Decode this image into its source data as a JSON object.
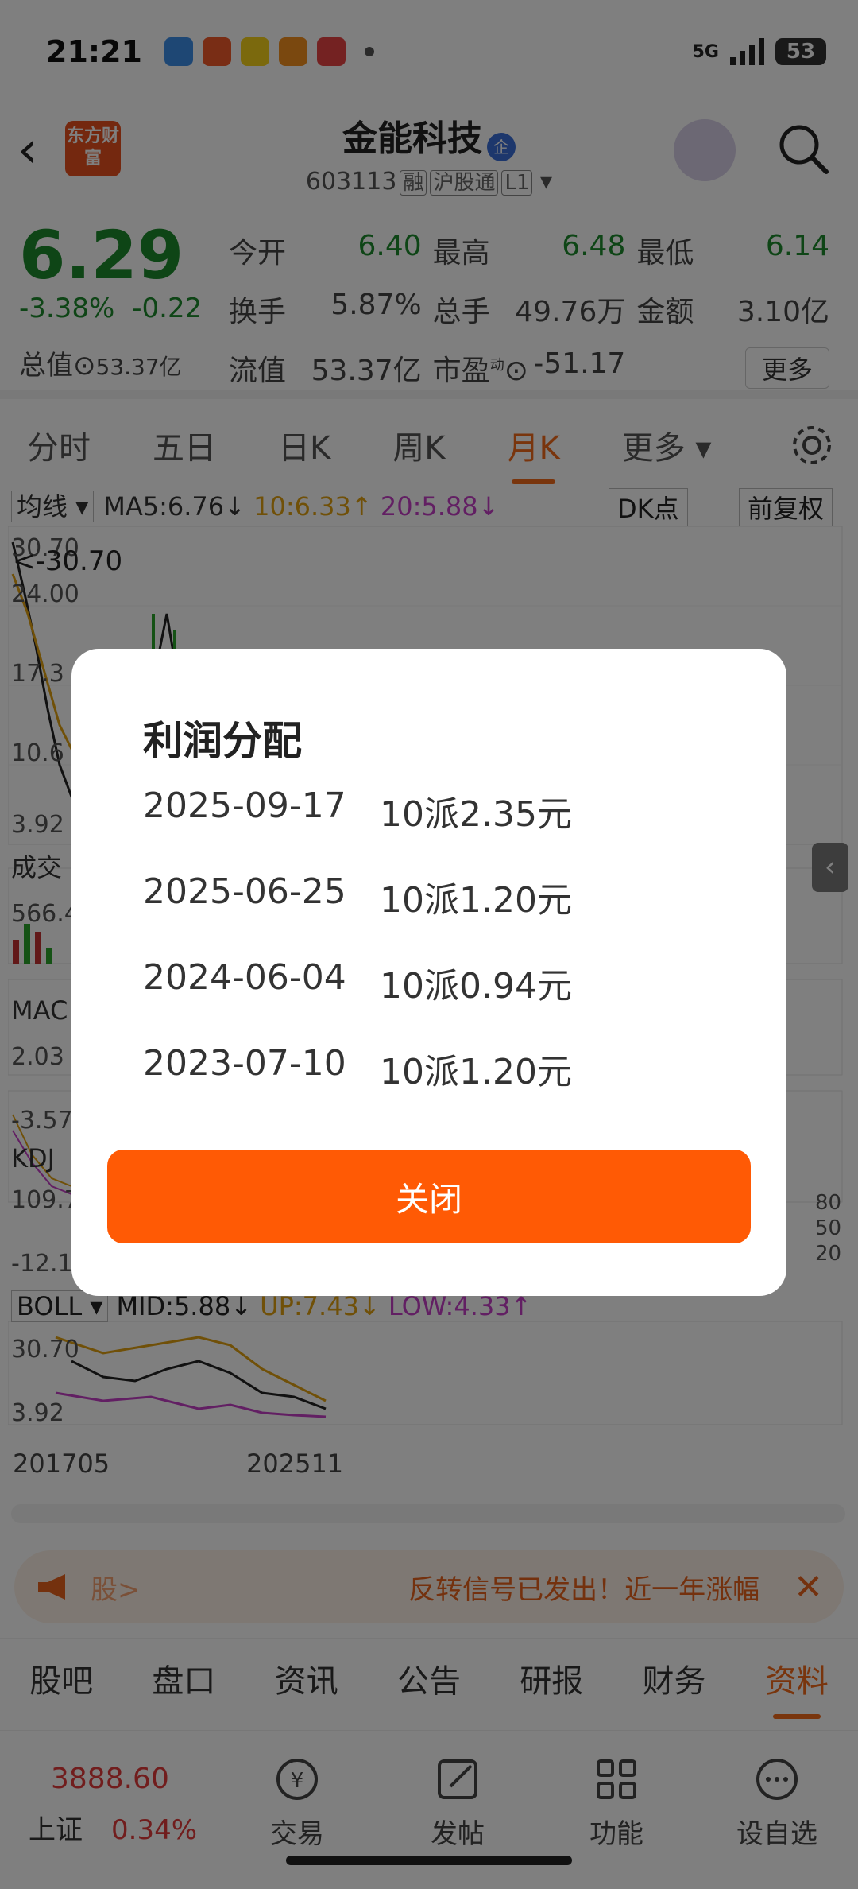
{
  "status_bar": {
    "time": "21:21",
    "network": "5G",
    "battery": "53"
  },
  "header": {
    "logo_text": "东方财富",
    "stock_name": "金能科技",
    "qi_badge": "企",
    "code": "603113",
    "tags": [
      "融",
      "沪股通",
      "L1"
    ]
  },
  "quote": {
    "price": "6.29",
    "change_pct": "-3.38%",
    "change_abs": "-0.22",
    "mktcap_label": "总值",
    "mktcap_value": "53.37亿",
    "rows": [
      [
        {
          "k": "今开",
          "v": "6.40"
        },
        {
          "k": "最高",
          "v": "6.48"
        },
        {
          "k": "最低",
          "v": "6.14"
        }
      ],
      [
        {
          "k": "换手",
          "v": "5.87%"
        },
        {
          "k": "总手",
          "v": "49.76万"
        },
        {
          "k": "金额",
          "v": "3.10亿"
        }
      ],
      [
        {
          "k": "流值",
          "v": "53.37亿"
        },
        {
          "k": "市盈",
          "v": "-51.17"
        }
      ]
    ],
    "pe_sup": "动",
    "more": "更多"
  },
  "period_tabs": [
    "分时",
    "五日",
    "日K",
    "周K",
    "月K",
    "更多"
  ],
  "chart": {
    "ma_selector": "均线",
    "ma5": "MA5:6.76",
    "ma10": "10:6.33",
    "ma20": "20:5.88",
    "dk": "DK点",
    "fq": "前复权",
    "y_labels": [
      "30.70",
      "24.00",
      "17.3",
      "10.6",
      "3.92"
    ],
    "max_marker": "<-30.70",
    "volume_label": "成交",
    "volume_value": "566.4",
    "macd_label": "MAC",
    "macd_values": [
      "2.03",
      "-3.57"
    ],
    "kdj_label": "KDJ",
    "kdj_values": [
      "109.7",
      "-12.1"
    ],
    "kdj_levels": [
      "80",
      "50",
      "20"
    ],
    "boll_selector": "BOLL",
    "boll_mid": "MID:5.88",
    "boll_up": "UP:7.43",
    "boll_low": "LOW:4.33",
    "boll_y": [
      "30.70",
      "3.92"
    ],
    "x_labels": [
      "201705",
      "202511"
    ]
  },
  "banner": {
    "gu": "股>",
    "msg": "反转信号已发出！近一年涨幅"
  },
  "info_tabs": [
    "股吧",
    "盘口",
    "资讯",
    "公告",
    "研报",
    "财务",
    "资料"
  ],
  "bottom_nav": {
    "index_value": "3888.60",
    "index_name": "上证",
    "index_pct": "0.34%",
    "items": [
      "交易",
      "发帖",
      "功能",
      "设自选"
    ]
  },
  "modal": {
    "title": "利润分配",
    "rows": [
      {
        "date": "2025-09-17",
        "plan": "10派2.35元"
      },
      {
        "date": "2025-06-25",
        "plan": "10派1.20元"
      },
      {
        "date": "2024-06-04",
        "plan": "10派0.94元"
      },
      {
        "date": "2023-07-10",
        "plan": "10派1.20元"
      }
    ],
    "close_label": "关闭"
  }
}
